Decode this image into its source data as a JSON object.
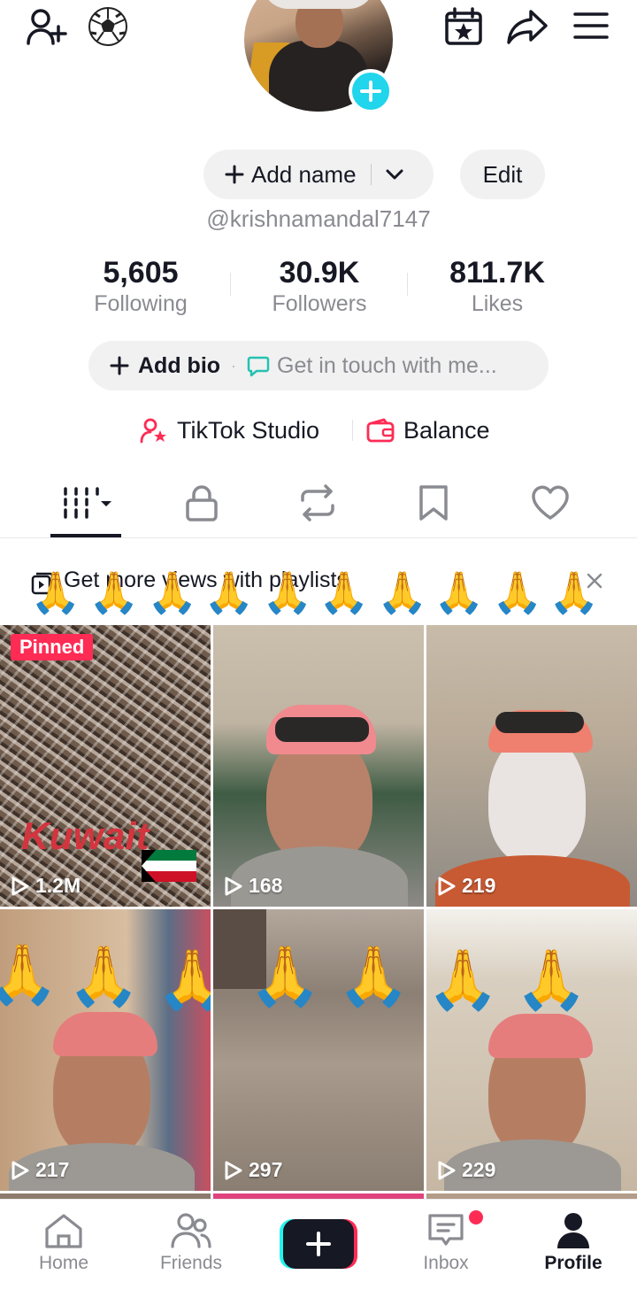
{
  "profile": {
    "add_name": "Add name",
    "edit": "Edit",
    "handle": "@krishnamandal7147"
  },
  "stats": [
    {
      "value": "5,605",
      "label": "Following"
    },
    {
      "value": "30.9K",
      "label": "Followers"
    },
    {
      "value": "811.7K",
      "label": "Likes"
    }
  ],
  "bio": {
    "add_bio": "Add bio",
    "get_in_touch": "Get in touch with me..."
  },
  "tools": {
    "studio": "TikTok Studio",
    "balance": "Balance"
  },
  "banner": {
    "text": "Get more views with playlists"
  },
  "videos": [
    {
      "views": "1.2M",
      "pinned_label": "Pinned",
      "overlay_text": "Kuwait"
    },
    {
      "views": "168"
    },
    {
      "views": "219"
    },
    {
      "views": "217"
    },
    {
      "views": "297"
    },
    {
      "views": "229"
    }
  ],
  "nav": {
    "home": "Home",
    "friends": "Friends",
    "inbox": "Inbox",
    "profile": "Profile"
  },
  "colors": {
    "accent": "#fe2c55",
    "cyan": "#20d5ec",
    "text": "#161823",
    "muted": "#8a8b91"
  }
}
